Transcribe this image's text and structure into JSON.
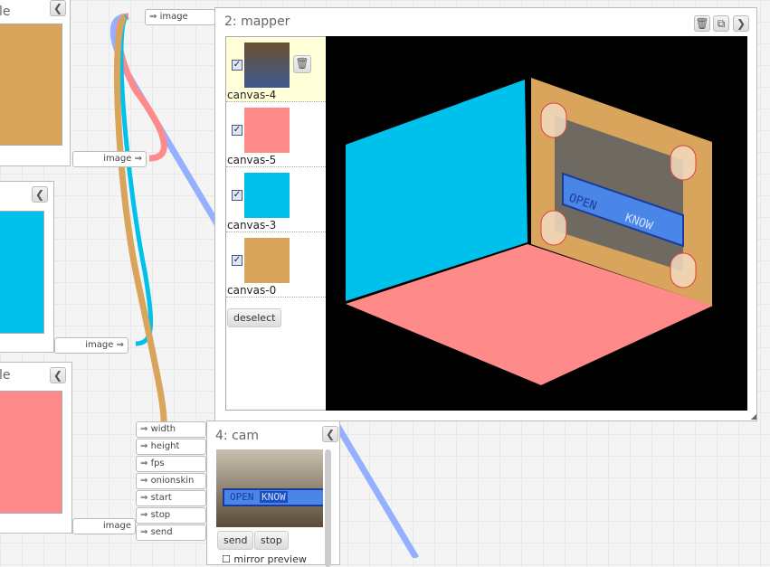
{
  "colors": {
    "orange": "#d9a45c",
    "cyan": "#00c0ec",
    "pink": "#ff8a8a",
    "blue_wire": "#8aa8ff"
  },
  "left_panels": [
    {
      "title": "le",
      "color": "#d9a45c",
      "output": "image"
    },
    {
      "title": "",
      "color": "#00c0ec",
      "output": "image"
    },
    {
      "title": "le",
      "color": "#ff8a8a",
      "output": "image"
    }
  ],
  "mapper": {
    "title": "2: mapper",
    "input": "image",
    "icons": [
      "trash-icon",
      "clone-icon",
      "chevron-right-icon"
    ],
    "layers": [
      {
        "label": "canvas-4",
        "checked": true,
        "kind": "camera"
      },
      {
        "label": "canvas-5",
        "checked": true,
        "color": "#ff8a8a"
      },
      {
        "label": "canvas-3",
        "checked": true,
        "color": "#00c0ec"
      },
      {
        "label": "canvas-0",
        "checked": true,
        "color": "#d9a45c"
      }
    ],
    "deselect": "deselect"
  },
  "cam": {
    "title": "4: cam",
    "inputs": [
      "width",
      "height",
      "fps",
      "onionskin",
      "start",
      "stop",
      "send"
    ],
    "output": "image",
    "send": "send",
    "stop": "stop",
    "mirror": "mirror preview",
    "banner_a": "OPEN",
    "banner_b": "KNOW"
  }
}
